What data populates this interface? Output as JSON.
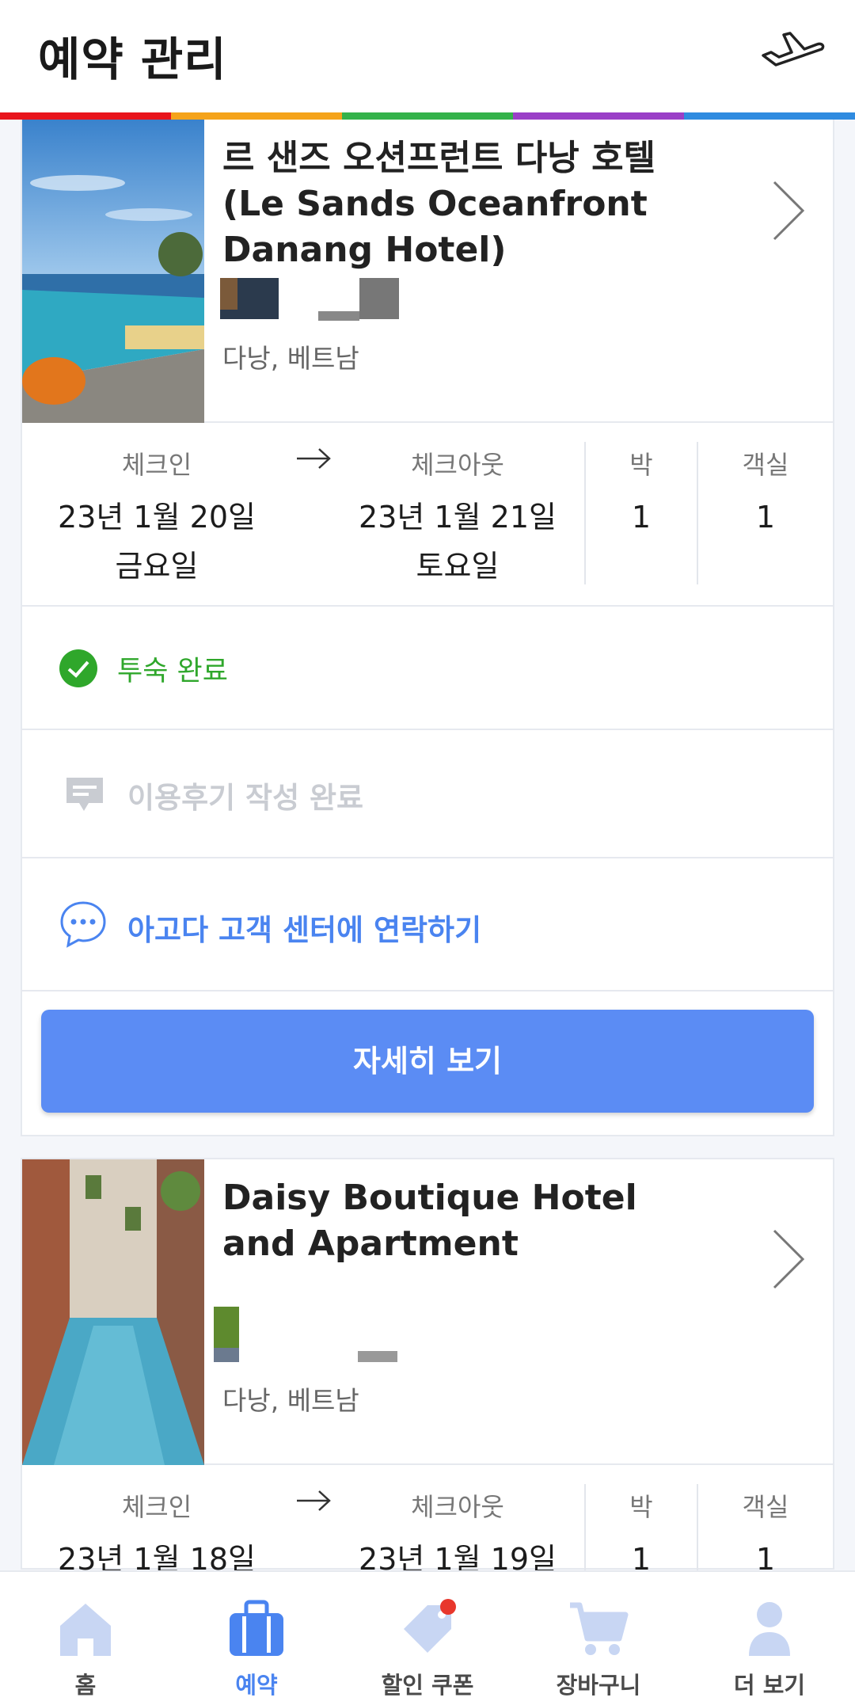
{
  "header": {
    "title": "예약 관리",
    "plane_icon": "airplane-icon",
    "rainbow": [
      "#e8141c",
      "#f5a31a",
      "#34b24a",
      "#9a3fc7",
      "#2f8be0"
    ]
  },
  "bookings": [
    {
      "hotel_name": "르 샌즈 오션프런트 다낭 호텔 (Le Sands Oceanfront Danang Hotel)",
      "location": "다낭, 베트남",
      "checkin_label": "체크인",
      "checkin_date": "23년 1월 20일",
      "checkin_day": "금요일",
      "checkout_label": "체크아웃",
      "checkout_date": "23년 1월 21일",
      "checkout_day": "토요일",
      "nights_label": "박",
      "nights": "1",
      "rooms_label": "객실",
      "rooms": "1",
      "status": "투숙 완료",
      "review": "이용후기 작성 완료",
      "contact": "아고다 고객 센터에 연락하기",
      "detail_button": "자세히 보기"
    },
    {
      "hotel_name": "Daisy Boutique Hotel and Apartment",
      "location": "다낭, 베트남",
      "checkin_label": "체크인",
      "checkin_date": "23년 1월 18일",
      "checkout_label": "체크아웃",
      "checkout_date": "23년 1월 19일",
      "nights_label": "박",
      "nights": "1",
      "rooms_label": "객실",
      "rooms": "1"
    }
  ],
  "colors": {
    "accent": "#5b8cf4",
    "status_green": "#2fa72b",
    "review_gray": "#c9ccd2",
    "contact_blue": "#4a84f0"
  },
  "bottom_nav": [
    {
      "label": "홈",
      "icon": "home-icon"
    },
    {
      "label": "예약",
      "icon": "briefcase-icon",
      "active": true
    },
    {
      "label": "할인 쿠폰",
      "icon": "tag-icon"
    },
    {
      "label": "장바구니",
      "icon": "cart-icon"
    },
    {
      "label": "더 보기",
      "icon": "person-icon"
    }
  ]
}
